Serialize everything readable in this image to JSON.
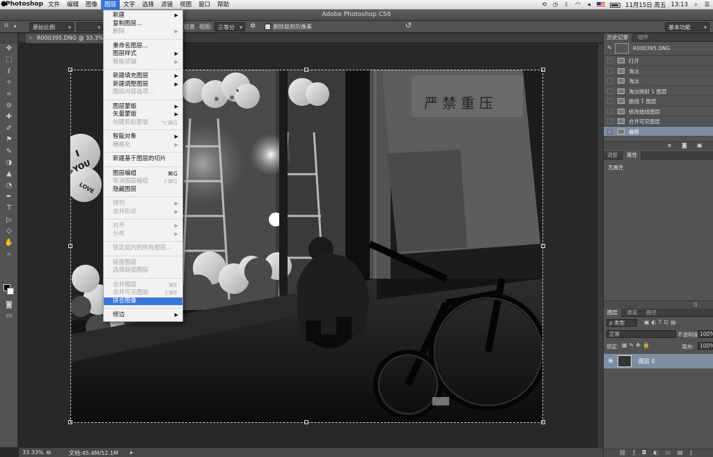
{
  "macbar": {
    "app": "Photoshop",
    "menus": [
      "文件",
      "编辑",
      "图像",
      "图层",
      "文字",
      "选择",
      "滤镜",
      "视图",
      "窗口",
      "帮助"
    ],
    "active_menu": "图层",
    "date": "11月15日 周五",
    "time": "13:13"
  },
  "window": {
    "title": "Adobe Photoshop CS6"
  },
  "options": {
    "ratio": "原始比例",
    "straighten": "拉直",
    "view_label": "视图:",
    "view_value": "三等分",
    "delete_cropped": "删除裁剪的像素",
    "workspace": "基本功能"
  },
  "document": {
    "tab": "R000395.DNG @ 33.3% (图"
  },
  "status": {
    "zoom": "33.33%",
    "doc": "文档:45.4M/52.1M"
  },
  "layer_menu": [
    {
      "label": "新建",
      "arrow": true,
      "group": 0
    },
    {
      "label": "复制图层...",
      "group": 0
    },
    {
      "label": "删除",
      "disabled": true,
      "arrow": true,
      "group": 0
    },
    {
      "label": "重命名图层...",
      "group": 1
    },
    {
      "label": "图层样式",
      "arrow": true,
      "group": 1
    },
    {
      "label": "智能滤镜",
      "disabled": true,
      "arrow": true,
      "group": 1
    },
    {
      "label": "新建填充图层",
      "arrow": true,
      "group": 2
    },
    {
      "label": "新建调整图层",
      "arrow": true,
      "group": 2
    },
    {
      "label": "图层内容选项...",
      "disabled": true,
      "group": 2
    },
    {
      "label": "图层蒙版",
      "arrow": true,
      "group": 3
    },
    {
      "label": "矢量蒙版",
      "arrow": true,
      "group": 3
    },
    {
      "label": "创建剪贴蒙版",
      "disabled": true,
      "shortcut": "⌥⌘G",
      "group": 3
    },
    {
      "label": "智能对象",
      "arrow": true,
      "group": 4
    },
    {
      "label": "栅格化",
      "disabled": true,
      "arrow": true,
      "group": 4
    },
    {
      "label": "新建基于图层的切片",
      "group": 5
    },
    {
      "label": "图层编组",
      "shortcut": "⌘G",
      "group": 6
    },
    {
      "label": "取消图层编组",
      "disabled": true,
      "shortcut": "⇧⌘G",
      "group": 6
    },
    {
      "label": "隐藏图层",
      "group": 6
    },
    {
      "label": "排列",
      "disabled": true,
      "arrow": true,
      "group": 7
    },
    {
      "label": "合并形状",
      "disabled": true,
      "arrow": true,
      "group": 7
    },
    {
      "label": "对齐",
      "disabled": true,
      "arrow": true,
      "group": 8
    },
    {
      "label": "分布",
      "disabled": true,
      "arrow": true,
      "group": 8
    },
    {
      "label": "锁定组内的所有图层...",
      "disabled": true,
      "group": 9
    },
    {
      "label": "链接图层",
      "disabled": true,
      "group": 10
    },
    {
      "label": "选择链接图层",
      "disabled": true,
      "group": 10
    },
    {
      "label": "合并图层",
      "disabled": true,
      "shortcut": "⌘E",
      "group": 11
    },
    {
      "label": "合并可见图层",
      "disabled": true,
      "shortcut": "⇧⌘E",
      "group": 11
    },
    {
      "label": "拼合图像",
      "highlighted": true,
      "group": 11
    },
    {
      "label": "修边",
      "arrow": true,
      "group": 12
    }
  ],
  "history": {
    "tabs": [
      "历史记录",
      "动作"
    ],
    "snapshot": "R000395.DNG",
    "items": [
      "打开",
      "淘汰",
      "淘汰",
      "淘汰映射 1 图层",
      "曲线 1 图层",
      "修改曲线图层",
      "合并可见图层",
      "裁剪"
    ],
    "selected_index": 7
  },
  "properties": {
    "tabs": [
      "调整",
      "属性"
    ],
    "empty_text": "无属性"
  },
  "layers": {
    "tabs": [
      "图层",
      "通道",
      "路径"
    ],
    "filter": "类型",
    "blend_mode": "正常",
    "opacity_label": "不透明度:",
    "opacity_value": "100%",
    "lock_label": "锁定:",
    "fill_label": "填充:",
    "fill_value": "100%",
    "layer_name": "图层 0"
  },
  "photo_text": {
    "sign": "严  禁  重  压",
    "balloon_text_1": "I",
    "balloon_text_2": "YOU",
    "balloon_text_3": "LOVE"
  }
}
